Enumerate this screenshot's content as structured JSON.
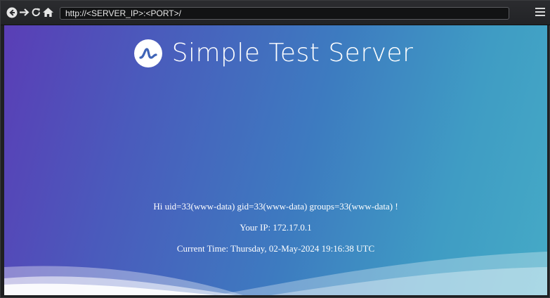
{
  "browser": {
    "url": "http://<SERVER_IP>:<PORT>/",
    "icons": [
      "back-icon",
      "forward-icon",
      "reload-icon",
      "home-icon",
      "menu-icon"
    ]
  },
  "page": {
    "title": "Simple Test Server",
    "greeting": "Hi uid=33(www-data) gid=33(www-data) groups=33(www-data) !",
    "ip_line": "Your IP: 172.17.0.1",
    "time_line": "Current Time: Thursday, 02-May-2024 19:16:38 UTC"
  },
  "colors": {
    "gradient_start": "#5a3eb6",
    "gradient_end": "#45aac6",
    "toolbar": "#2b2c2f",
    "text": "#ffffff"
  }
}
